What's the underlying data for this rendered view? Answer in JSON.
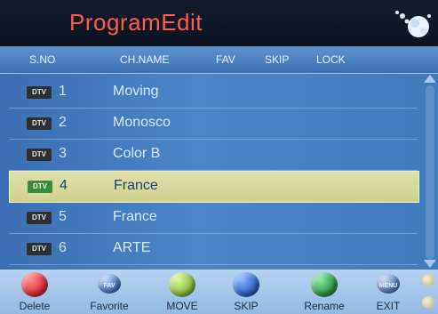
{
  "title": "ProgramEdit",
  "colors": {
    "title": "#ff5a4d",
    "selected_row": "#d9dca0",
    "list_bg": "#4a86c8"
  },
  "header": {
    "sno": "S.NO",
    "chname": "CH.NAME",
    "fav": "FAV",
    "skip": "SKIP",
    "lock": "LOCK"
  },
  "channels": [
    {
      "type": "DTV",
      "number": "1",
      "name": "Moving",
      "selected": false
    },
    {
      "type": "DTV",
      "number": "2",
      "name": "Monosco",
      "selected": false
    },
    {
      "type": "DTV",
      "number": "3",
      "name": "Color B",
      "selected": false
    },
    {
      "type": "DTV",
      "number": "4",
      "name": "France",
      "selected": true
    },
    {
      "type": "DTV",
      "number": "5",
      "name": "France",
      "selected": false
    },
    {
      "type": "DTV",
      "number": "6",
      "name": "ARTE",
      "selected": false
    }
  ],
  "footer": {
    "delete": {
      "label": "Delete",
      "color": "#e0313b"
    },
    "favorite": {
      "label": "Favorite",
      "icon_text": "FAV",
      "color": "#4f7fc9"
    },
    "move": {
      "label": "MOVE",
      "color": "#8fbe3e"
    },
    "skip": {
      "label": "SKIP",
      "color": "#2e67c9"
    },
    "rename": {
      "label": "Rename",
      "color": "#2e9a4c"
    },
    "exit": {
      "label": "EXIT",
      "icon_text": "MENU",
      "color": "#5d7fc0"
    }
  }
}
